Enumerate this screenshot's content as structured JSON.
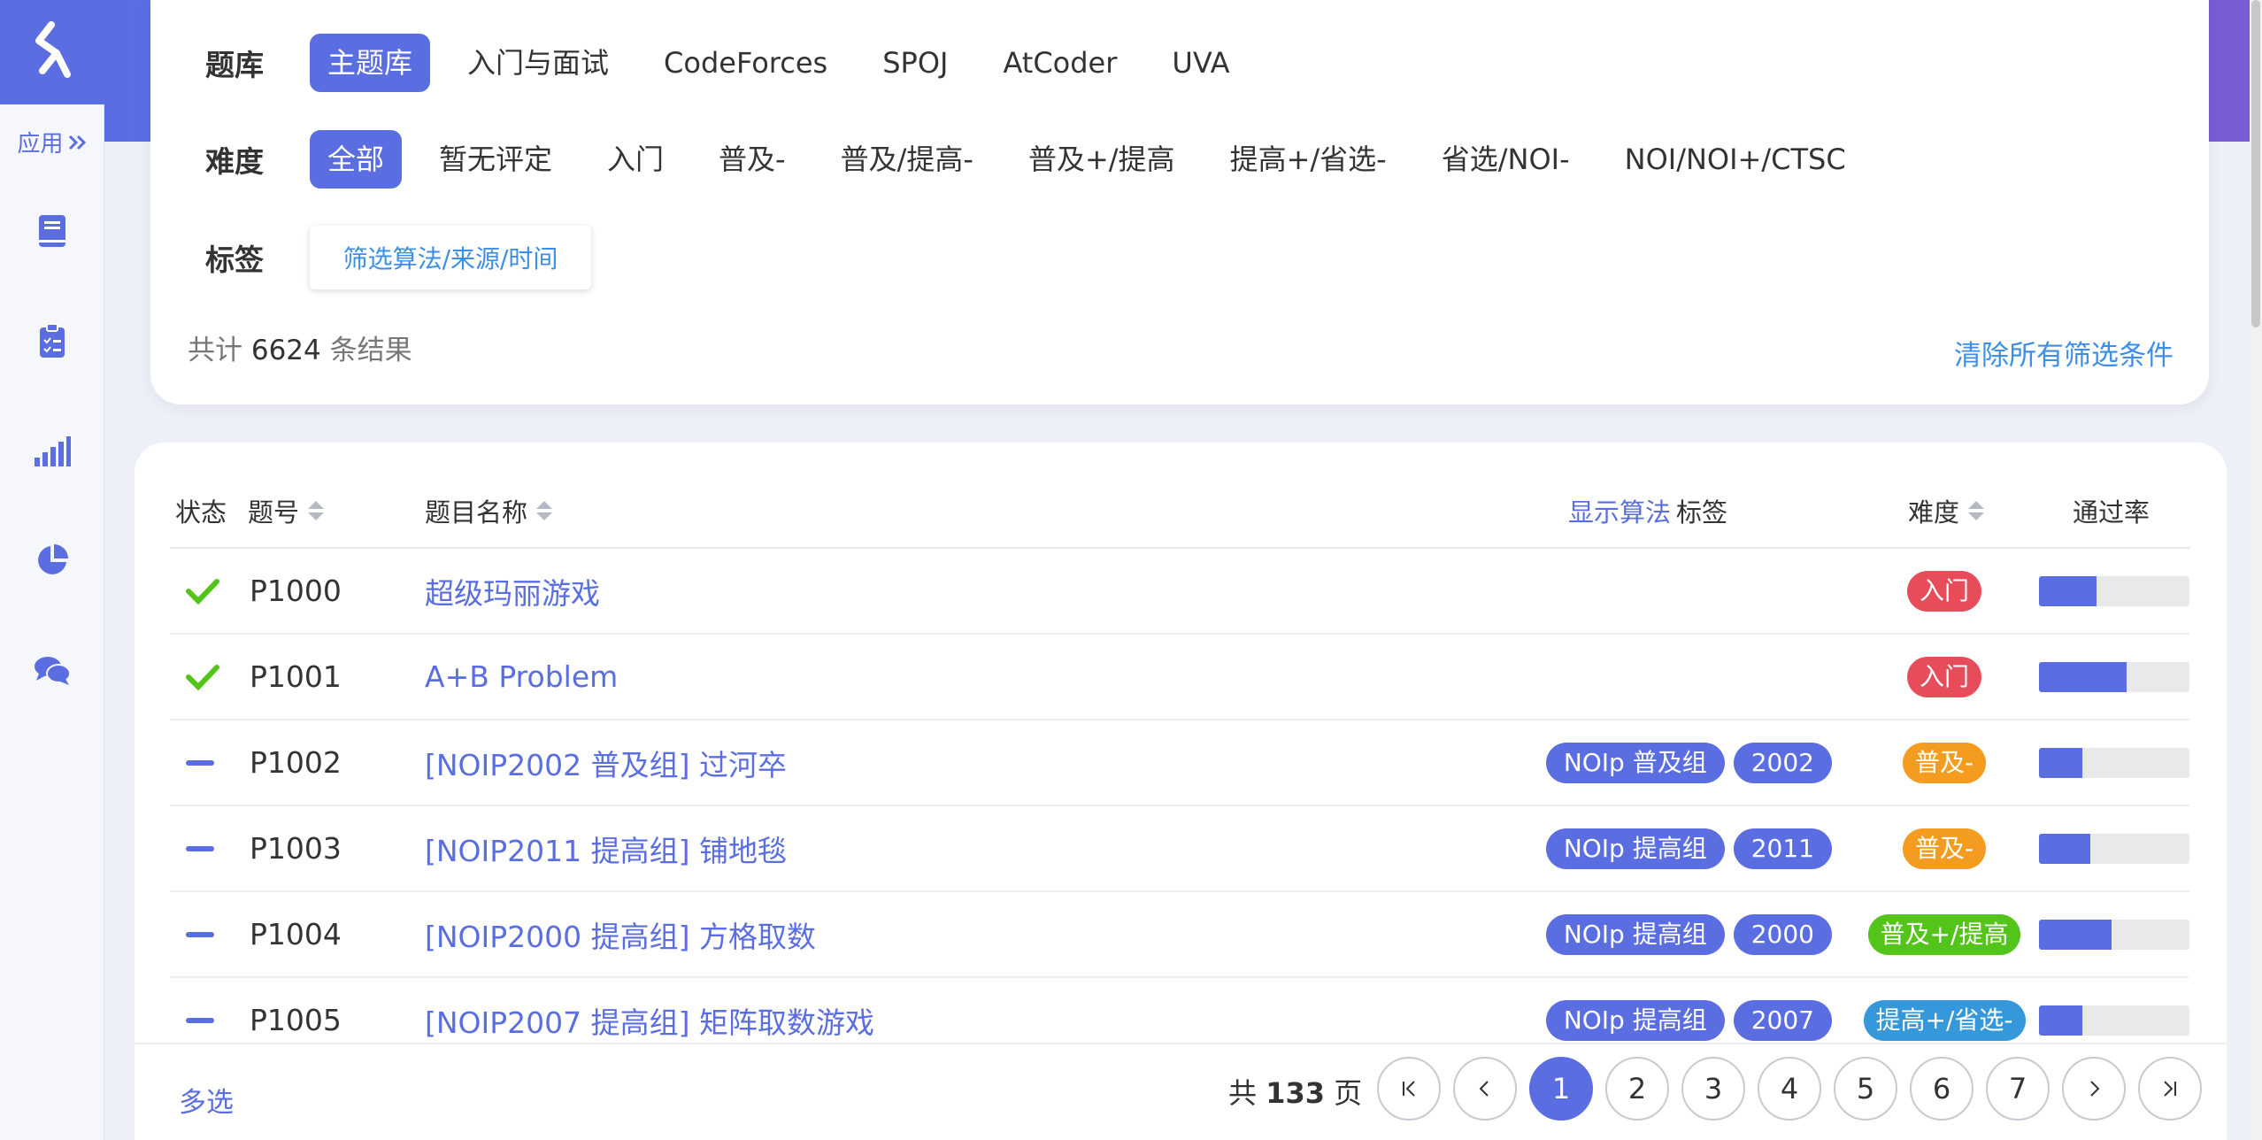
{
  "sidebar": {
    "app_label": "应用",
    "icons": [
      "book-icon",
      "clipboard-icon",
      "bar-signal-icon",
      "pie-chart-icon",
      "chat-icon"
    ]
  },
  "filters": {
    "library_label": "题库",
    "library_options": [
      "主题库",
      "入门与面试",
      "CodeForces",
      "SPOJ",
      "AtCoder",
      "UVA"
    ],
    "difficulty_label": "难度",
    "difficulty_options": [
      "全部",
      "暂无评定",
      "入门",
      "普及-",
      "普及/提高-",
      "普及+/提高",
      "提高+/省选-",
      "省选/NOI-",
      "NOI/NOI+/CTSC"
    ],
    "tag_label": "标签",
    "tag_select_label": "筛选算法/来源/时间",
    "result_prefix": "共计",
    "result_count": "6624",
    "result_suffix": "条结果",
    "clear_label": "清除所有筛选条件"
  },
  "table": {
    "headers": {
      "status": "状态",
      "id": "题号",
      "title": "题目名称",
      "show_algo": "显示算法",
      "tags": "标签",
      "difficulty": "难度",
      "pass_rate": "通过率"
    },
    "rows": [
      {
        "status": "solved",
        "id": "P1000",
        "title": "超级玛丽游戏",
        "tags": [],
        "difficulty": "入门",
        "diff_color": "#e74c5b",
        "pass_rate": 0.38
      },
      {
        "status": "solved",
        "id": "P1001",
        "title": "A+B Problem",
        "tags": [],
        "difficulty": "入门",
        "diff_color": "#e74c5b",
        "pass_rate": 0.58
      },
      {
        "status": "none",
        "id": "P1002",
        "title": "[NOIP2002 普及组] 过河卒",
        "tags": [
          "NOIp 普及组",
          "2002"
        ],
        "difficulty": "普及-",
        "diff_color": "#f39c1f",
        "pass_rate": 0.29
      },
      {
        "status": "none",
        "id": "P1003",
        "title": "[NOIP2011 提高组] 铺地毯",
        "tags": [
          "NOIp 提高组",
          "2011"
        ],
        "difficulty": "普及-",
        "diff_color": "#f39c1f",
        "pass_rate": 0.34
      },
      {
        "status": "none",
        "id": "P1004",
        "title": "[NOIP2000 提高组] 方格取数",
        "tags": [
          "NOIp 提高组",
          "2000"
        ],
        "difficulty": "普及+/提高",
        "diff_color": "#52c41a",
        "pass_rate": 0.48
      },
      {
        "status": "none",
        "id": "P1005",
        "title": "[NOIP2007 提高组] 矩阵取数游戏",
        "tags": [
          "NOIp 提高组",
          "2007"
        ],
        "difficulty": "提高+/省选-",
        "diff_color": "#3498db",
        "pass_rate": 0.29
      }
    ]
  },
  "pager": {
    "multi_label": "多选",
    "total_prefix": "共",
    "total_pages": "133",
    "total_suffix": "页",
    "pages": [
      "1",
      "2",
      "3",
      "4",
      "5",
      "6",
      "7"
    ],
    "current": "1"
  },
  "colors": {
    "primary": "#5b6ee1",
    "link": "#3d8ee6",
    "solved": "#52c41a"
  }
}
